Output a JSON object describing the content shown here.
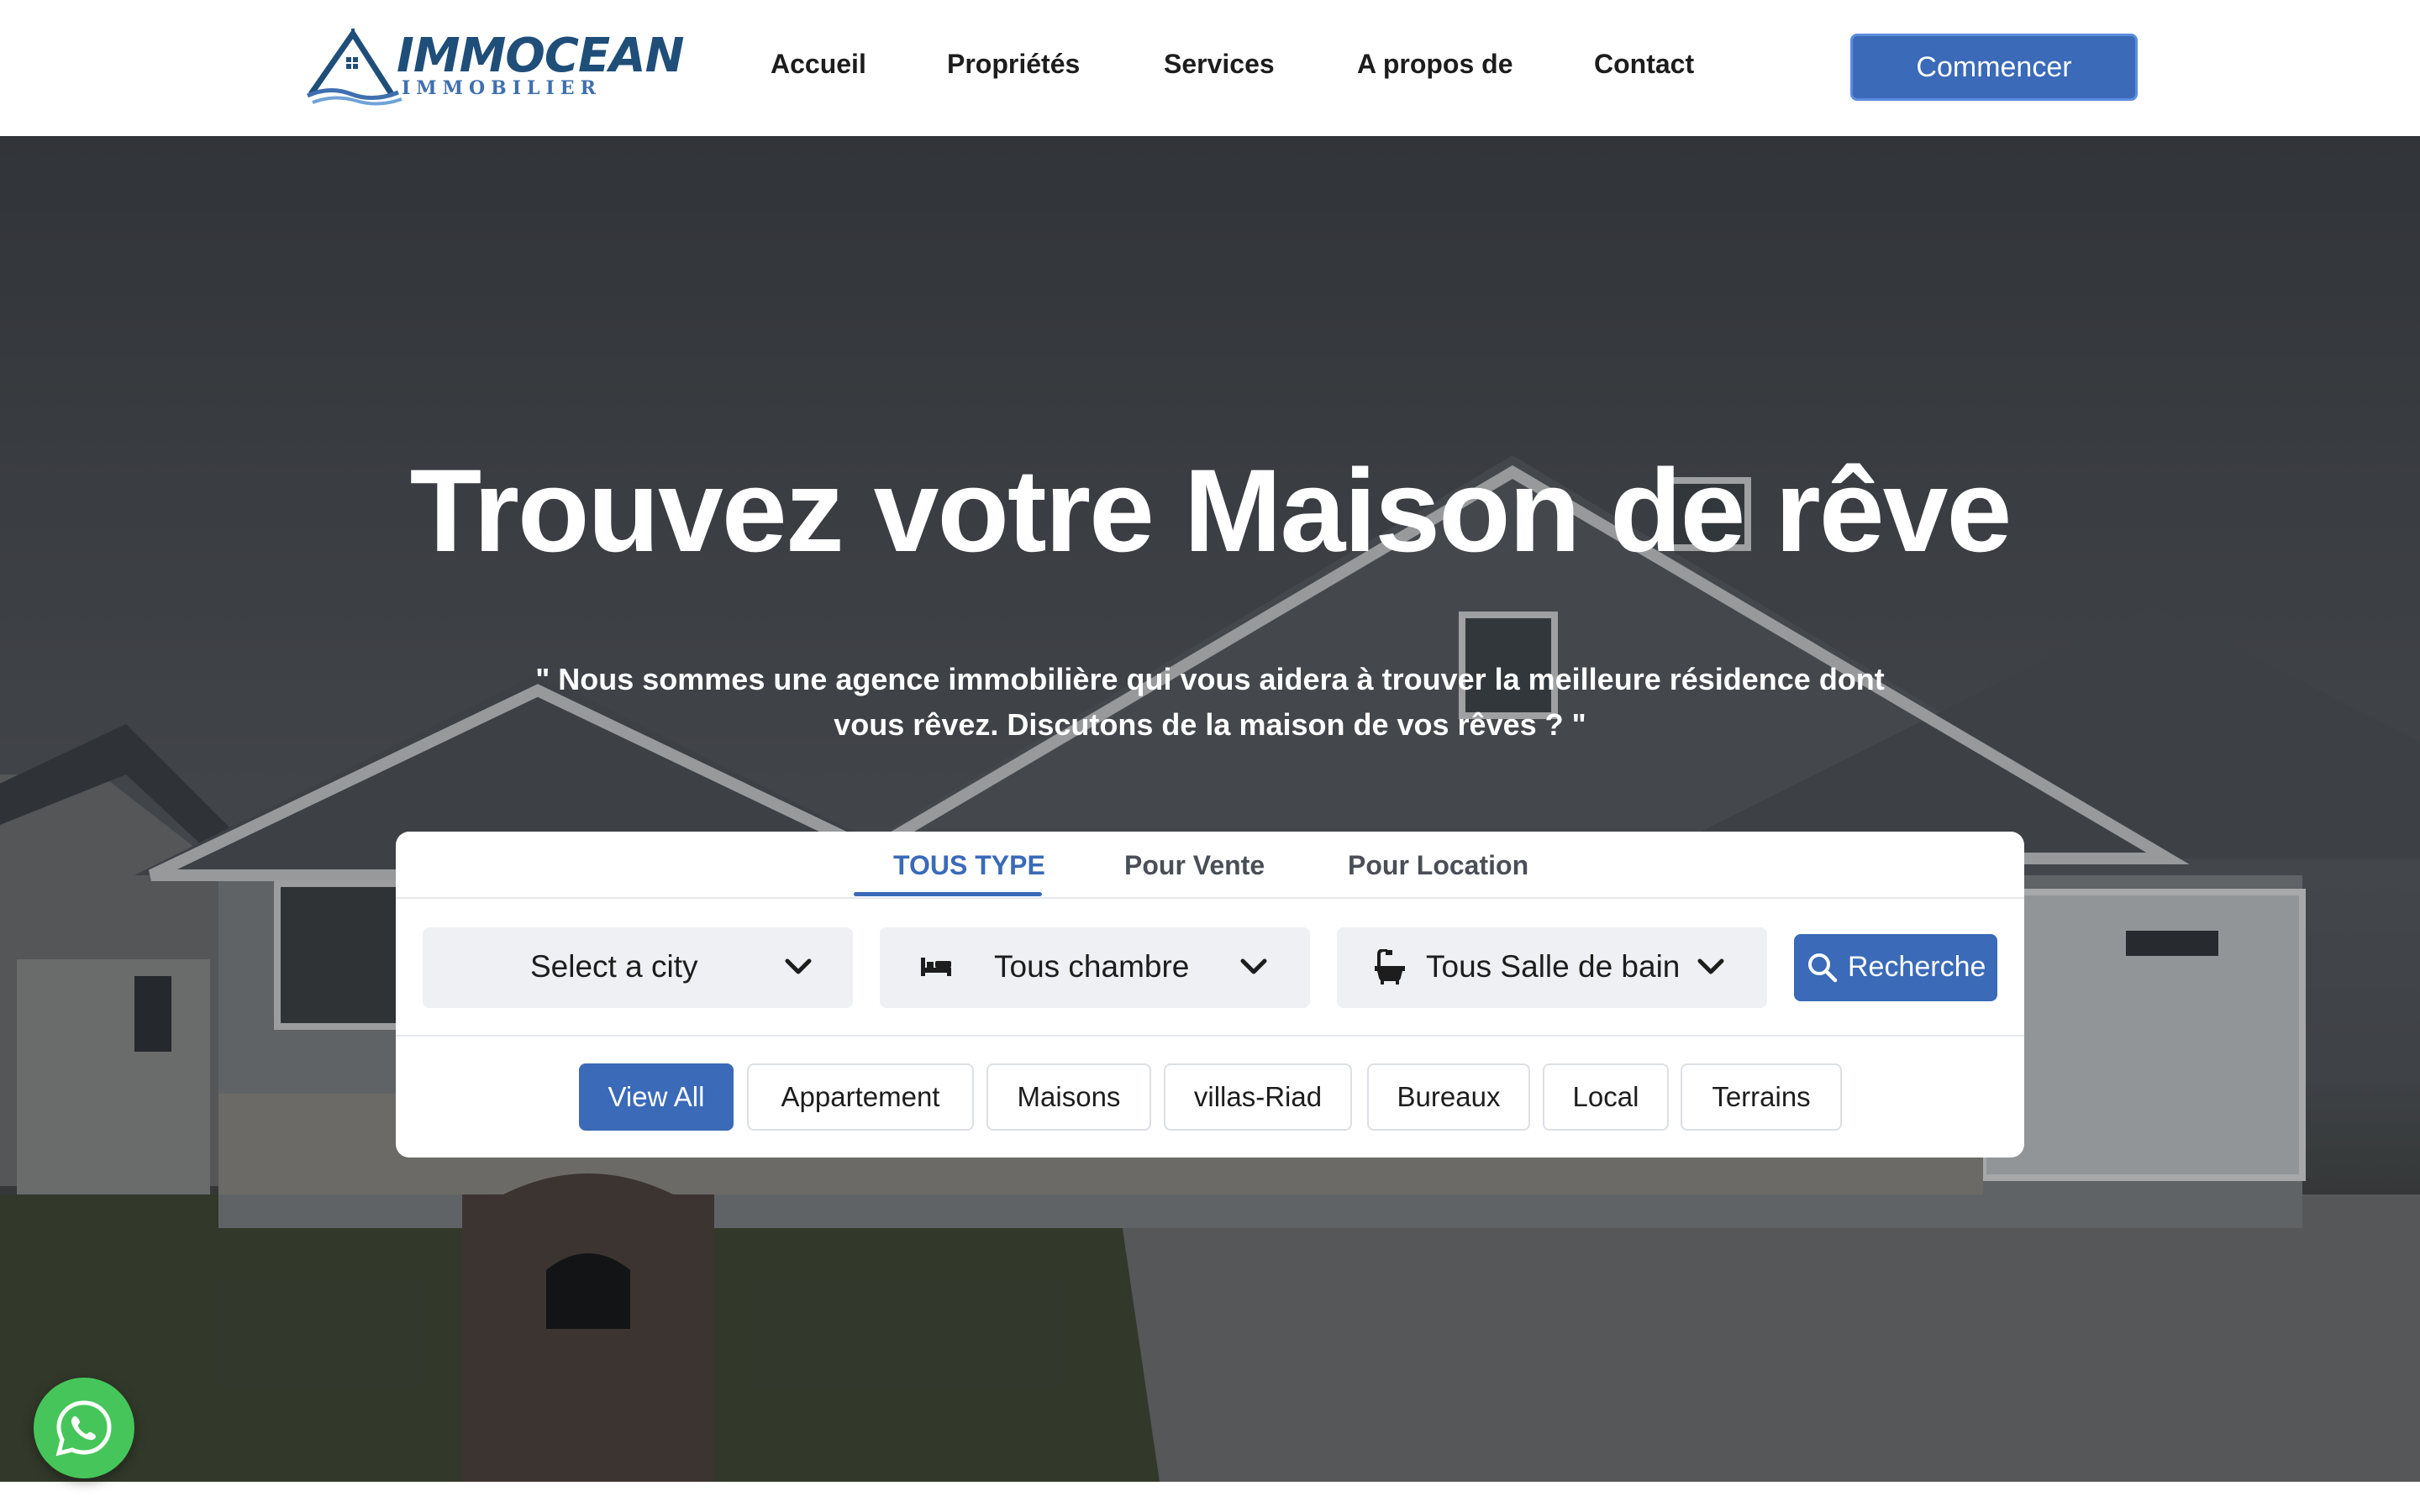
{
  "brand": {
    "name": "IMMOCEAN",
    "tagline": "IMMOBILIER",
    "primary_color": "#3a6ab8",
    "dark_color": "#1f4e79"
  },
  "nav": {
    "items": [
      {
        "label": "Accueil"
      },
      {
        "label": "Propriétés"
      },
      {
        "label": "Services"
      },
      {
        "label": "A propos de"
      },
      {
        "label": "Contact"
      }
    ],
    "cta_label": "Commencer"
  },
  "hero": {
    "title": "Trouvez votre Maison de rêve",
    "subtitle_line1": "\" Nous sommes une agence immobilière qui vous aidera à trouver la meilleure résidence dont",
    "subtitle_line2": "vous rêvez. Discutons de la maison de vos rêves ? \""
  },
  "search": {
    "tabs": [
      {
        "label": "TOUS TYPE",
        "active": true
      },
      {
        "label": "Pour Vente",
        "active": false
      },
      {
        "label": "Pour Location",
        "active": false
      }
    ],
    "city_select": {
      "value": "Select a city",
      "icon": "chevron-down-icon"
    },
    "bedroom_select": {
      "value": "Tous chambre",
      "icon": "bed-icon"
    },
    "bathroom_select": {
      "value": "Tous Salle de bain",
      "icon": "bathtub-icon"
    },
    "search_button": {
      "label": "Recherche",
      "icon": "search-icon"
    }
  },
  "categories": [
    {
      "label": "View All",
      "active": true
    },
    {
      "label": "Appartement",
      "active": false
    },
    {
      "label": "Maisons",
      "active": false
    },
    {
      "label": "villas-Riad",
      "active": false
    },
    {
      "label": "Bureaux",
      "active": false
    },
    {
      "label": "Local",
      "active": false
    },
    {
      "label": "Terrains",
      "active": false
    }
  ],
  "floating": {
    "whatsapp_icon": "whatsapp-icon",
    "whatsapp_color": "#46c65a"
  }
}
